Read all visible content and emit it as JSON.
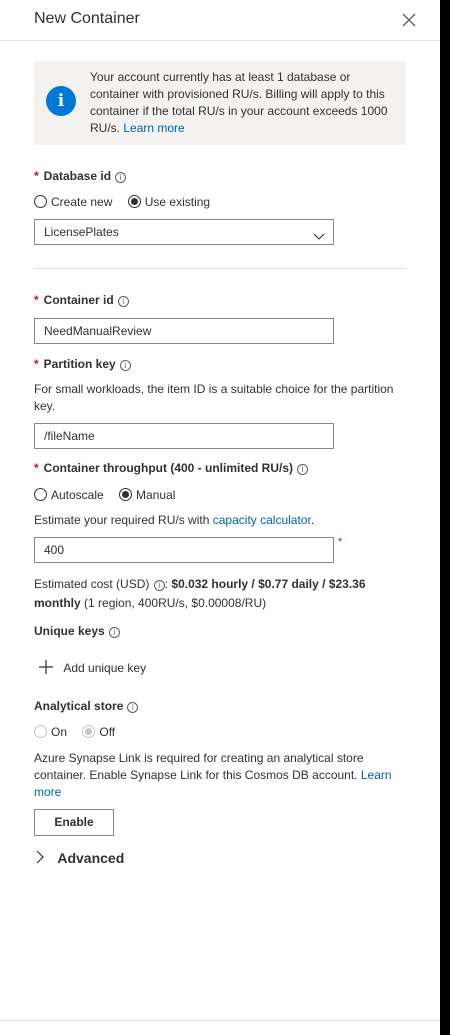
{
  "panel": {
    "title": "New Container"
  },
  "info": {
    "text": "Your account currently has at least 1 database or container with provisioned RU/s. Billing will apply to this container if the total RU/s in your account exceeds 1000 RU/s.",
    "link": "Learn more",
    "icon": "info-icon"
  },
  "database": {
    "label": "Database id",
    "options": [
      "Create new",
      "Use existing"
    ],
    "selected": "Use existing",
    "value": "LicensePlates"
  },
  "container": {
    "label": "Container id",
    "value": "NeedManualReview"
  },
  "partition": {
    "label": "Partition key",
    "help": "For small workloads, the item ID is a suitable choice for the partition key.",
    "value": "/fileName"
  },
  "throughput": {
    "label": "Container throughput (400 - unlimited RU/s)",
    "options": [
      "Autoscale",
      "Manual"
    ],
    "selected": "Manual",
    "estimate_text": "Estimate your required RU/s with",
    "estimate_link": "capacity calculator",
    "estimate_period": ".",
    "value": "400",
    "required_marker": "*",
    "cost_prefix": "Estimated cost (USD)",
    "cost_colon": ":",
    "cost_bold_1": "$0.032 hourly / $0.77 daily / $23.36",
    "cost_bold_2": "monthly",
    "cost_detail": "(1 region, 400RU/s, $0.00008/RU)"
  },
  "unique_keys": {
    "label": "Unique keys",
    "add_label": "Add unique key"
  },
  "analytical": {
    "label": "Analytical store",
    "options": [
      "On",
      "Off"
    ],
    "selected": "Off",
    "help": "Azure Synapse Link is required for creating an analytical store container. Enable Synapse Link for this Cosmos DB account.",
    "link": "Learn more",
    "enable_label": "Enable"
  },
  "advanced": {
    "label": "Advanced"
  },
  "required_marker": "*",
  "info_glyph": "i"
}
